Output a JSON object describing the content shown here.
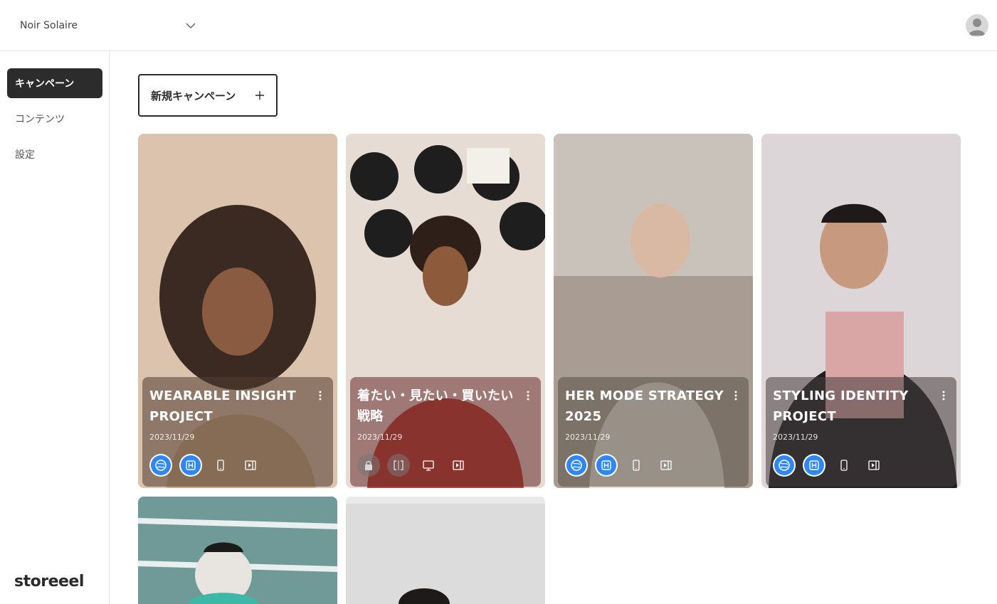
{
  "header": {
    "store_name": "Noir Solaire"
  },
  "sidebar": {
    "items": [
      {
        "label": "キャンペーン",
        "active": true
      },
      {
        "label": "コンテンツ",
        "active": false
      },
      {
        "label": "設定",
        "active": false
      }
    ],
    "logo": "storeeel"
  },
  "main": {
    "new_campaign_label": "新規キャンペーン",
    "cards": [
      {
        "title": "WEARABLE INSIGHT PROJECT",
        "date": "2023/11/29",
        "status": [
          "globe-active",
          "h-active",
          "mobile",
          "player"
        ]
      },
      {
        "title": "着たい・見たい・買いたい戦略",
        "date": "2023/11/29",
        "status": [
          "lock",
          "split",
          "desktop",
          "player"
        ]
      },
      {
        "title": "HER MODE STRATEGY 2025",
        "date": "2023/11/29",
        "status": [
          "globe-active",
          "h-active",
          "mobile",
          "player"
        ]
      },
      {
        "title": "STYLING IDENTITY PROJECT",
        "date": "2023/11/29",
        "status": [
          "globe-active",
          "h-active",
          "mobile",
          "player"
        ]
      },
      {
        "title": "",
        "date": "",
        "status": []
      },
      {
        "title": "",
        "date": "",
        "status": []
      }
    ]
  },
  "colors": {
    "accent_blue": "#2f86f6",
    "active_nav": "#2c2c2c"
  }
}
